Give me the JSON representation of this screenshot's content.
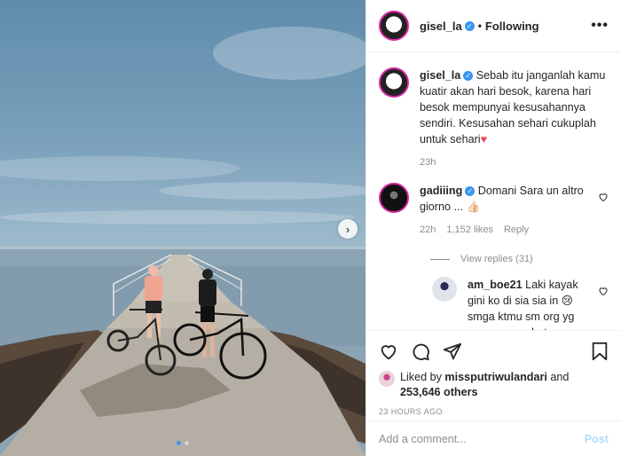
{
  "header": {
    "username": "gisel_la",
    "follow_status": "Following",
    "more_label": "•••",
    "separator": "•"
  },
  "caption": {
    "username": "gisel_la",
    "text": "Sebab itu janganlah kamu kuatir akan hari besok, karena hari besok mempunyai kesusahannya sendiri. Kesusahan sehari cukuplah untuk sehari",
    "emoji": "♥",
    "time": "23h"
  },
  "comments": [
    {
      "username": "gadiiing",
      "text": "Domani Sara un altro giorno ... 👍🏻",
      "time": "22h",
      "likes": "1,152 likes",
      "reply_label": "Reply",
      "view_replies": "View replies (31)"
    }
  ],
  "reply": {
    "username": "am_boe21",
    "text": "Laki kayak gini ko di sia sia in 😢 smga ktmu sm org yg svaaaaaaaa bat sm"
  },
  "actions": {
    "liked_by_prefix": "Liked by",
    "liked_by_user": "missputriwulandari",
    "and_label": "and",
    "others": "253,646 others",
    "timestamp": "23 HOURS AGO"
  },
  "add_comment": {
    "placeholder": "Add a comment...",
    "post_label": "Post"
  },
  "carousel": {
    "slides": 2,
    "active_index": 0
  },
  "colors": {
    "verified": "#3897f0",
    "story_ring": "#d6249f",
    "post_disabled": "#b2dffc",
    "heart": "#ed4956"
  }
}
